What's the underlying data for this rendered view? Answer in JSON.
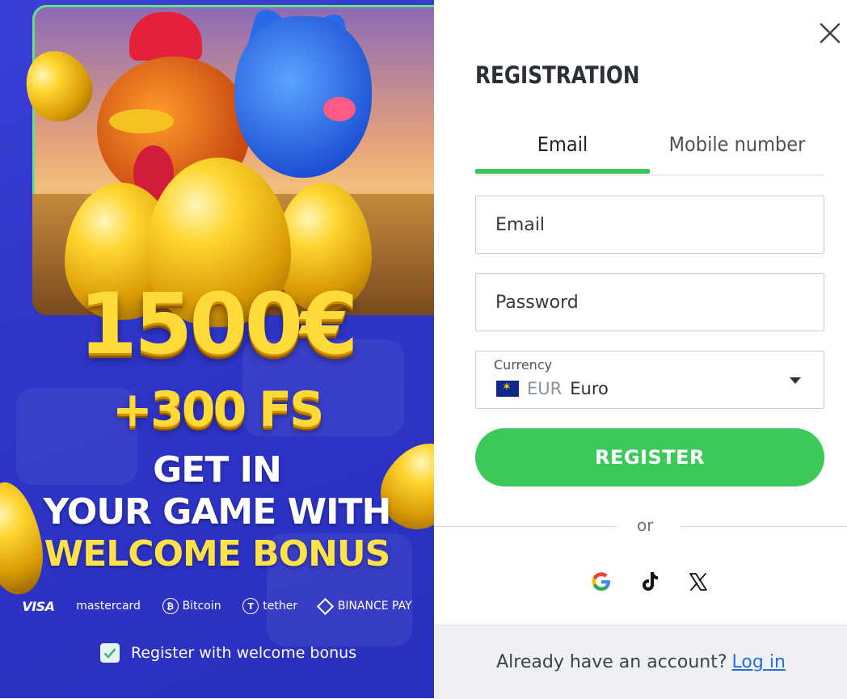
{
  "promo": {
    "bonus_amount": "1500€",
    "bonus_fs": "+300 FS",
    "line1": "GET IN",
    "line2": "YOUR GAME WITH",
    "line3": "WELCOME BONUS",
    "payments": [
      {
        "label": "VISA",
        "icon": "visa-logo"
      },
      {
        "label": "mastercard",
        "icon": "mastercard-logo"
      },
      {
        "label": "Bitcoin",
        "icon": "bitcoin-icon"
      },
      {
        "label": "tether",
        "icon": "tether-icon"
      },
      {
        "label": "BINANCE PAY",
        "icon": "binance-icon"
      }
    ],
    "welcome_bonus_label": "Register with welcome bonus",
    "welcome_bonus_checked": true
  },
  "form": {
    "title": "REGISTRATION",
    "tabs": [
      {
        "label": "Email",
        "active": true
      },
      {
        "label": "Mobile number",
        "active": false
      }
    ],
    "email_placeholder": "Email",
    "password_placeholder": "Password",
    "currency_label": "Currency",
    "currency_code": "EUR",
    "currency_name": "Euro",
    "register_label": "REGISTER",
    "or_text": "or",
    "social": [
      "google-icon",
      "tiktok-icon",
      "x-icon"
    ],
    "footer_text": "Already have an account?",
    "login_link": "Log in"
  },
  "colors": {
    "accent_green": "#3bc95a",
    "promo_blue": "#2f36c9",
    "bonus_yellow": "#ffdb3a",
    "link_blue": "#2a6fd6"
  }
}
